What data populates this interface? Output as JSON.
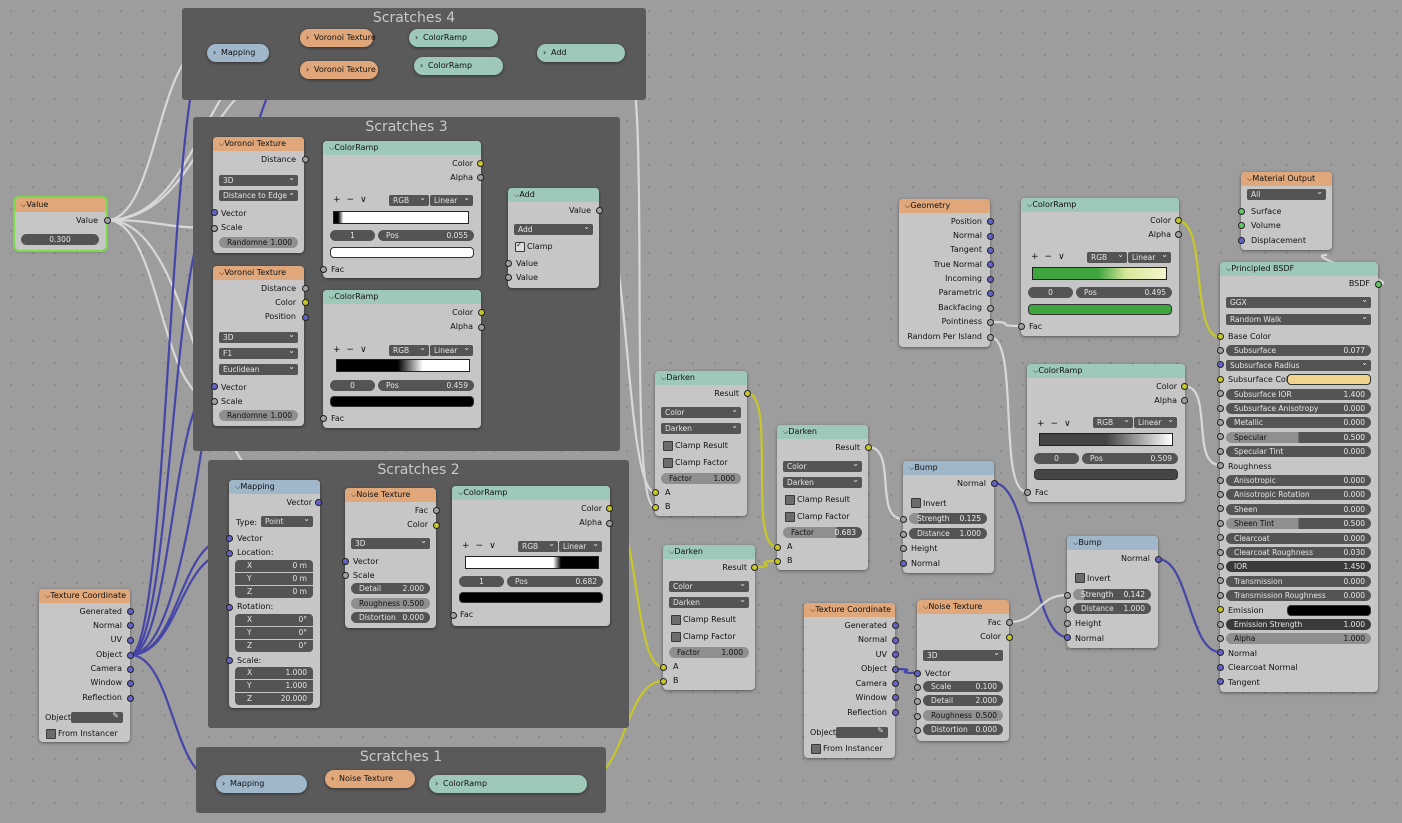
{
  "frames": {
    "s4": "Scratches 4",
    "s3": "Scratches 3",
    "s2": "Scratches 2",
    "s1": "Scratches 1"
  },
  "common": {
    "vector": "Vector",
    "scale": "Scale",
    "fac": "Fac",
    "color": "Color",
    "alpha": "Alpha",
    "value": "Value",
    "result": "Result",
    "normal": "Normal",
    "distance": "Distance",
    "position": "Position",
    "a": "A",
    "b": "B",
    "plus": "+",
    "minus": "−",
    "menu": "∨",
    "rgb": "RGB",
    "linear": "Linear",
    "pos": "Pos",
    "d3": "3D",
    "darken": "Darken",
    "color_mode": "Color",
    "clamp_result": "Clamp Result",
    "clamp_factor": "Clamp Factor",
    "factor": "Factor",
    "strength": "Strength",
    "invert": "Invert",
    "height": "Height",
    "detail": "Detail",
    "roughness": "Roughness",
    "distortion": "Distortion",
    "randomness": "Randomne",
    "add": "Add",
    "clamp": "Clamp"
  },
  "pills": {
    "mapping": "Mapping",
    "voronoi": "Voronoi Texture",
    "colorramp": "ColorRamp",
    "add": "Add",
    "noise": "Noise Texture"
  },
  "value_node": {
    "title": "Value",
    "out": "Value",
    "val": "0.300"
  },
  "vor1": {
    "title": "Voronoi Texture",
    "dims": "3D",
    "feature": "Distance to Edge",
    "rand": "1.000"
  },
  "vor2": {
    "title": "Voronoi Texture",
    "dims": "3D",
    "feature": "F1",
    "metric": "Euclidean",
    "rand": "1.000"
  },
  "cr_a": {
    "title": "ColorRamp",
    "idx": "1",
    "pos": "0.055"
  },
  "cr_b": {
    "title": "ColorRamp",
    "idx": "0",
    "pos": "0.459"
  },
  "add3": {
    "title": "Add",
    "op": "Add"
  },
  "mapping2": {
    "title": "Mapping",
    "type_label": "Type:",
    "type": "Point",
    "location": "Location:",
    "rotation": "Rotation:",
    "scale": "Scale:",
    "x": "X",
    "y": "Y",
    "z": "Z",
    "loc": [
      "0 m",
      "0 m",
      "0 m"
    ],
    "rot": [
      "0°",
      "0°",
      "0°"
    ],
    "scl": [
      "1.000",
      "1.000",
      "20.000"
    ]
  },
  "noise2": {
    "title": "Noise Texture",
    "dims": "3D",
    "detail": "2.000",
    "rough": "0.500",
    "dist": "0.000"
  },
  "cr_c": {
    "title": "ColorRamp",
    "idx": "1",
    "pos": "0.682"
  },
  "texcoord1": {
    "title": "Texture Coordinate",
    "outs": [
      "Generated",
      "Normal",
      "UV",
      "Object",
      "Camera",
      "Window",
      "Reflection"
    ],
    "object": "Object:",
    "instancer": "From Instancer"
  },
  "darken1": {
    "title": "Darken",
    "factor": "1.000"
  },
  "darken2": {
    "title": "Darken",
    "factor": "1.000"
  },
  "darken3": {
    "title": "Darken",
    "factor": "0.683"
  },
  "geometry": {
    "title": "Geometry",
    "outs": [
      "Position",
      "Normal",
      "Tangent",
      "True Normal",
      "Incoming",
      "Parametric",
      "Backfacing",
      "Pointiness",
      "Random Per Island"
    ]
  },
  "cr_d": {
    "title": "ColorRamp",
    "idx": "0",
    "pos": "0.495"
  },
  "cr_e": {
    "title": "ColorRamp",
    "idx": "0",
    "pos": "0.509"
  },
  "bump1": {
    "title": "Bump",
    "strength": "0.125",
    "distance": "1.000"
  },
  "bump2": {
    "title": "Bump",
    "strength": "0.142",
    "distance": "1.000"
  },
  "texcoord2": {
    "title": "Texture Coordinate",
    "outs": [
      "Generated",
      "Normal",
      "UV",
      "Object",
      "Camera",
      "Window",
      "Reflection"
    ],
    "object": "Object:",
    "instancer": "From Instancer"
  },
  "noise3": {
    "title": "Noise Texture",
    "dims": "3D",
    "scale": "0.100",
    "detail": "2.000",
    "rough": "0.500",
    "dist": "0.000"
  },
  "matout": {
    "title": "Material Output",
    "target": "All",
    "ins": [
      "Surface",
      "Volume",
      "Displacement"
    ]
  },
  "bsdf": {
    "title": "Principled BSDF",
    "out": "BSDF",
    "dist": "GGX",
    "sss": "Random Walk",
    "rows": [
      {
        "l": "Base Color",
        "t": "label"
      },
      {
        "l": "Subsurface",
        "v": "0.077",
        "t": "field"
      },
      {
        "l": "Subsurface Radius",
        "t": "dd"
      },
      {
        "l": "Subsurface Color",
        "t": "swatch",
        "c": "#f3d48c"
      },
      {
        "l": "Subsurface IOR",
        "v": "1.400",
        "t": "field"
      },
      {
        "l": "Subsurface Anisotropy",
        "v": "0.000",
        "t": "field"
      },
      {
        "l": "Metallic",
        "v": "0.000",
        "t": "field"
      },
      {
        "l": "Specular",
        "v": "0.500",
        "t": "field",
        "fill": 0.5
      },
      {
        "l": "Specular Tint",
        "v": "0.000",
        "t": "field"
      },
      {
        "l": "Roughness",
        "t": "label"
      },
      {
        "l": "Anisotropic",
        "v": "0.000",
        "t": "field"
      },
      {
        "l": "Anisotropic Rotation",
        "v": "0.000",
        "t": "field"
      },
      {
        "l": "Sheen",
        "v": "0.000",
        "t": "field"
      },
      {
        "l": "Sheen Tint",
        "v": "0.500",
        "t": "field",
        "fill": 0.5
      },
      {
        "l": "Clearcoat",
        "v": "0.000",
        "t": "field"
      },
      {
        "l": "Clearcoat Roughness",
        "v": "0.030",
        "t": "field"
      },
      {
        "l": "IOR",
        "v": "1.450",
        "t": "field",
        "dark": true
      },
      {
        "l": "Transmission",
        "v": "0.000",
        "t": "field"
      },
      {
        "l": "Transmission Roughness",
        "v": "0.000",
        "t": "field"
      },
      {
        "l": "Emission",
        "t": "swatch",
        "c": "#000000"
      },
      {
        "l": "Emission Strength",
        "v": "1.000",
        "t": "field",
        "dark": true
      },
      {
        "l": "Alpha",
        "v": "1.000",
        "t": "field",
        "fill": 1
      },
      {
        "l": "Normal",
        "t": "label"
      },
      {
        "l": "Clearcoat Normal",
        "t": "label"
      },
      {
        "l": "Tangent",
        "t": "label"
      }
    ]
  }
}
